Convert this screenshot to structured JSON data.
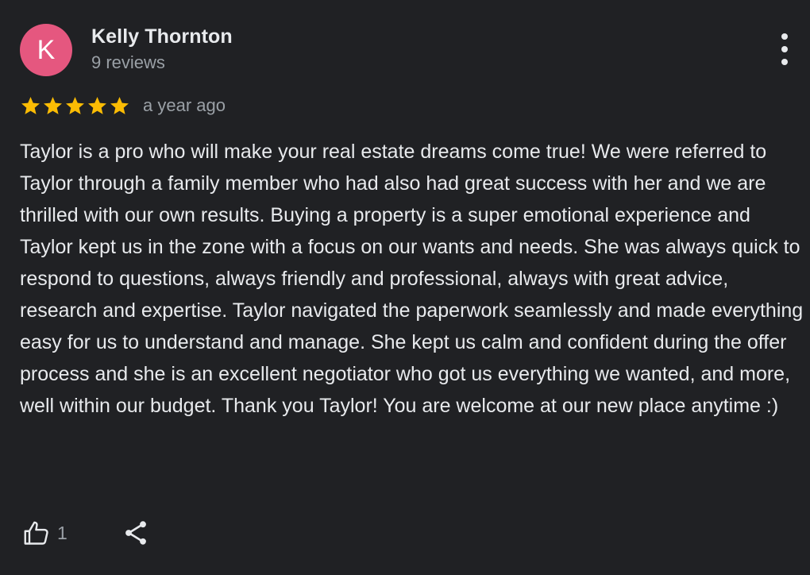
{
  "reviewer": {
    "avatar_letter": "K",
    "avatar_color": "#e5577f",
    "name": "Kelly Thornton",
    "review_count": "9 reviews"
  },
  "rating": {
    "stars": 5,
    "max_stars": 5,
    "star_color": "#fbbc04",
    "date": "a year ago"
  },
  "review": {
    "text": "Taylor is a pro who will make your real estate dreams come true! We were referred to Taylor through a family member who had also had great success with her and we are thrilled with our own results. Buying a property is a super emotional experience and Taylor kept us in the zone with a focus on our wants and needs. She was always quick to respond to questions, always friendly and professional, always with great advice, research and expertise. Taylor navigated the paperwork seamlessly and made everything easy for us to understand and manage. She kept us calm and confident during the offer process and she is an excellent negotiator who got us everything we wanted, and more, well within our budget. Thank you Taylor! You are welcome at our new place anytime :)"
  },
  "actions": {
    "like_icon": "thumbs-up-icon",
    "like_count": "1",
    "share_icon": "share-icon",
    "more_icon": "more-vert-icon"
  },
  "colors": {
    "background": "#202124",
    "primary_text": "#e8eaed",
    "secondary_text": "#9aa0a6"
  }
}
